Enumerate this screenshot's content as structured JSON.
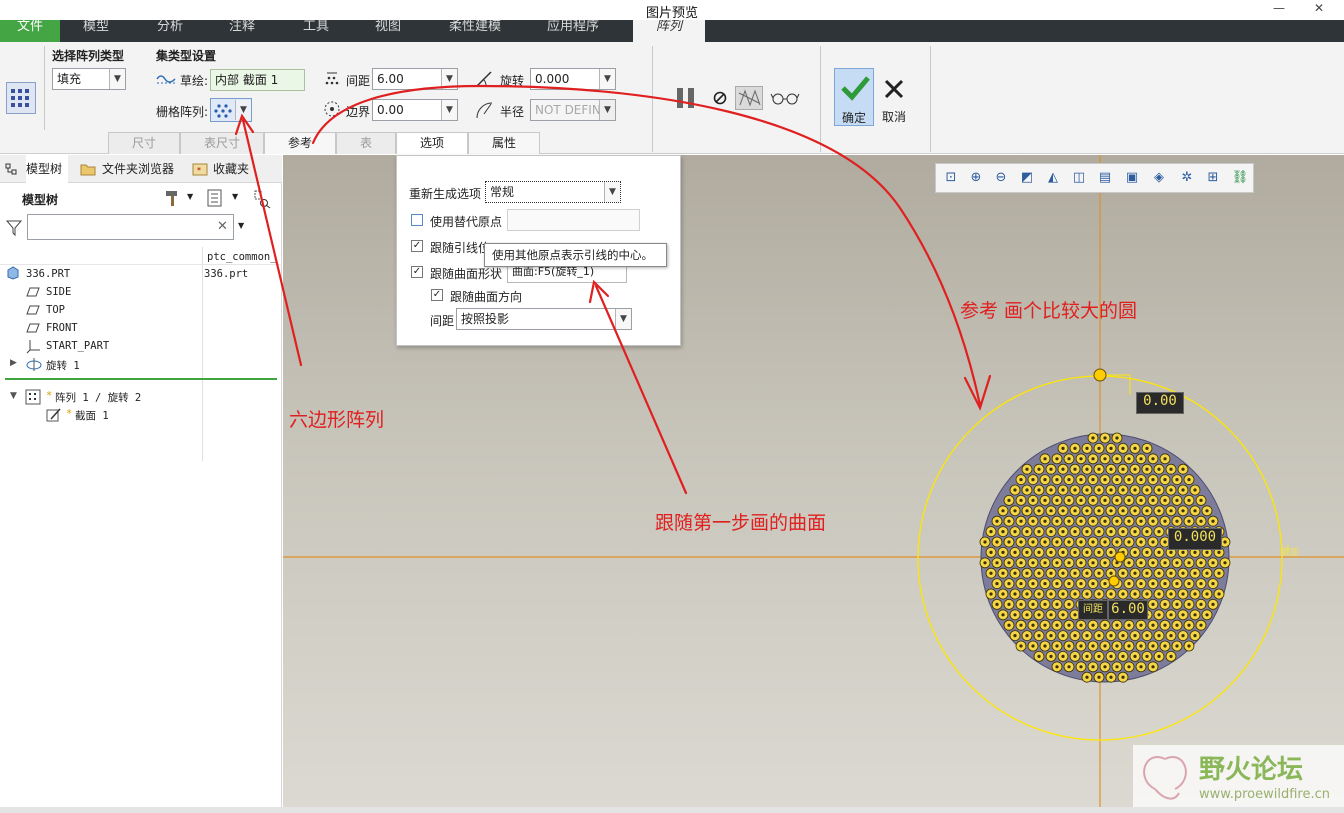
{
  "window": {
    "title": "图片预览",
    "minimize": "—",
    "close": "✕"
  },
  "menu": {
    "tabs": [
      "文件",
      "模型",
      "分析",
      "注释",
      "工具",
      "视图",
      "柔性建模",
      "应用程序",
      "阵列"
    ]
  },
  "ribbon": {
    "pattern_type_label": "选择阵列类型",
    "pattern_type_value": "填充",
    "set_type_label": "集类型设置",
    "sketch_label": "草绘:",
    "sketch_value": "内部 截面 1",
    "grid_label": "栅格阵列:",
    "spacing_label": "间距",
    "spacing_value": "6.00",
    "border_label": "边界",
    "border_value": "0.00",
    "rotation_label": "旋转",
    "rotation_value": "0.000",
    "radius_label": "半径",
    "radius_value": "NOT DEFIN",
    "ok_label": "确定",
    "cancel_label": "取消",
    "subtabs": [
      "尺寸",
      "表尺寸",
      "参考",
      "表",
      "选项",
      "属性"
    ]
  },
  "panel": {
    "tabs": [
      "模型树",
      "文件夹浏览器",
      "收藏夹"
    ],
    "tree_title": "模型树",
    "search_placeholder": "",
    "column_header": "ptc_common_",
    "column_value": "336.prt",
    "items": [
      "336.PRT",
      "SIDE",
      "TOP",
      "FRONT",
      "START_PART",
      "旋转 1",
      "阵列 1 / 旋转 2",
      "截面 1"
    ]
  },
  "options": {
    "regen_label": "重新生成选项",
    "regen_value": "常规",
    "alt_origin_label": "使用替代原点",
    "follow_leader_label": "跟随引线位",
    "follow_surface_label": "跟随曲面形状",
    "surface_value": "曲面:F5(旋转_1)",
    "follow_dir_label": "跟随曲面方向",
    "spacing_label": "间距",
    "spacing_value": "按照投影"
  },
  "tooltip": "使用其他原点表示引线的中心。",
  "viewport": {
    "dims": [
      "0.00",
      "0.000",
      "间距",
      "6.00"
    ],
    "plane_label": "截面",
    "wm_title": "野火论坛",
    "wm_url": "www.proewildfire.cn"
  },
  "annotations": {
    "hex": "六边形阵列",
    "circle": "参考 画个比较大的圆",
    "surface": "跟随第一步画的曲面"
  },
  "colors": {
    "accent": "#2f3438",
    "annotation": "#e02020",
    "highlight": "#ffd21f"
  }
}
